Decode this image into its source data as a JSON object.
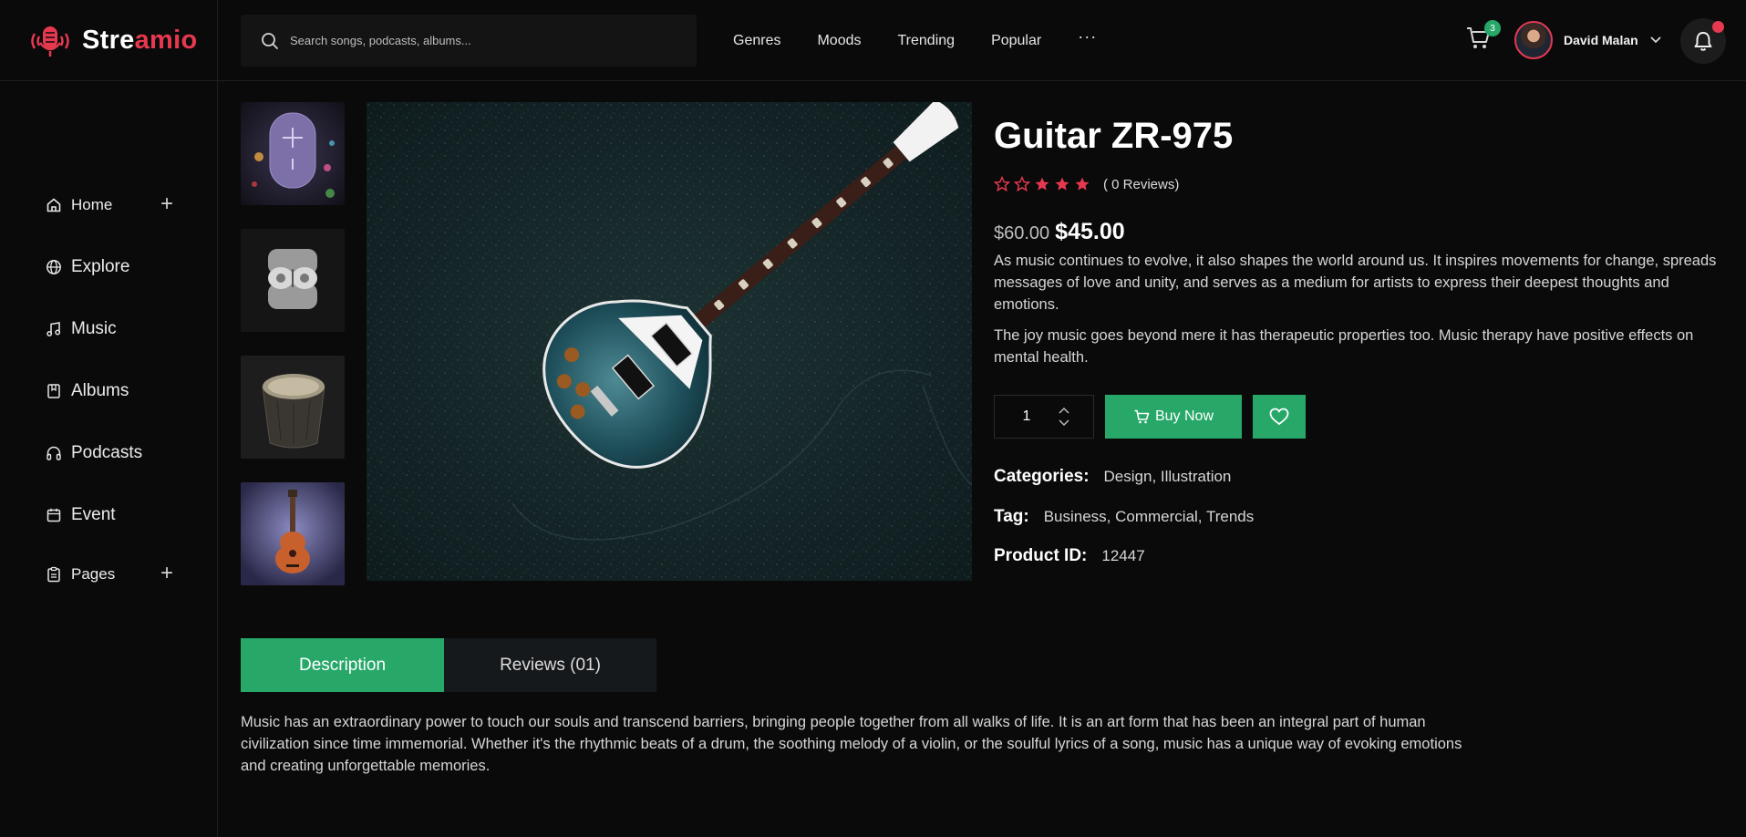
{
  "brand": {
    "name_part1": "Stre",
    "name_part2": "amio"
  },
  "search": {
    "placeholder": "Search songs, podcasts, albums..."
  },
  "topnav": {
    "items": [
      "Genres",
      "Moods",
      "Trending",
      "Popular"
    ],
    "more": "···"
  },
  "cart": {
    "count": "3"
  },
  "user": {
    "name": "David Malan"
  },
  "sidebar": {
    "items": [
      {
        "label": "Home",
        "icon": "home-icon",
        "expandable": true
      },
      {
        "label": "Explore",
        "icon": "globe-icon",
        "expandable": false
      },
      {
        "label": "Music",
        "icon": "music-note-icon",
        "expandable": false
      },
      {
        "label": "Albums",
        "icon": "album-icon",
        "expandable": false
      },
      {
        "label": "Podcasts",
        "icon": "headphones-icon",
        "expandable": false
      },
      {
        "label": "Event",
        "icon": "calendar-icon",
        "expandable": false
      },
      {
        "label": "Pages",
        "icon": "clipboard-icon",
        "expandable": true
      }
    ],
    "plus": "+"
  },
  "gallery": {
    "thumbnails": [
      "speaker-thumbnail",
      "earbuds-thumbnail",
      "drum-thumbnail",
      "guitar-thumbnail"
    ],
    "main": "guitar-main-image"
  },
  "product": {
    "title": "Guitar ZR-975",
    "rating": 3,
    "rating_max": 5,
    "reviews_label": "( 0 Reviews)",
    "old_price": "$60.00",
    "price": "$45.00",
    "description_1": "As music continues to evolve, it also shapes the world around us. It inspires movements for change, spreads messages of love and unity, and serves as a medium for artists to express their deepest thoughts and emotions.",
    "description_2": "The joy music goes beyond mere it has therapeutic properties too. Music therapy have positive effects on mental health.",
    "quantity": "1",
    "buy_label": "Buy Now",
    "categories_label": "Categories:",
    "categories": "Design, Illustration",
    "tag_label": "Tag:",
    "tags": "Business, Commercial, Trends",
    "id_label": "Product ID:",
    "id": "12447"
  },
  "tabs": {
    "description": "Description",
    "reviews": "Reviews (01)"
  },
  "long_description": "Music has an extraordinary power to touch our souls and transcend barriers, bringing people together from all walks of life. It is an art form that has been an integral part of human civilization since time immemorial. Whether it's the rhythmic beats of a drum, the soothing melody of a violin, or the soulful lyrics of a song, music has a unique way of evoking emotions and creating unforgettable memories.",
  "colors": {
    "accent": "#27a869",
    "brand": "#e63950",
    "background": "#0a0a0a"
  }
}
